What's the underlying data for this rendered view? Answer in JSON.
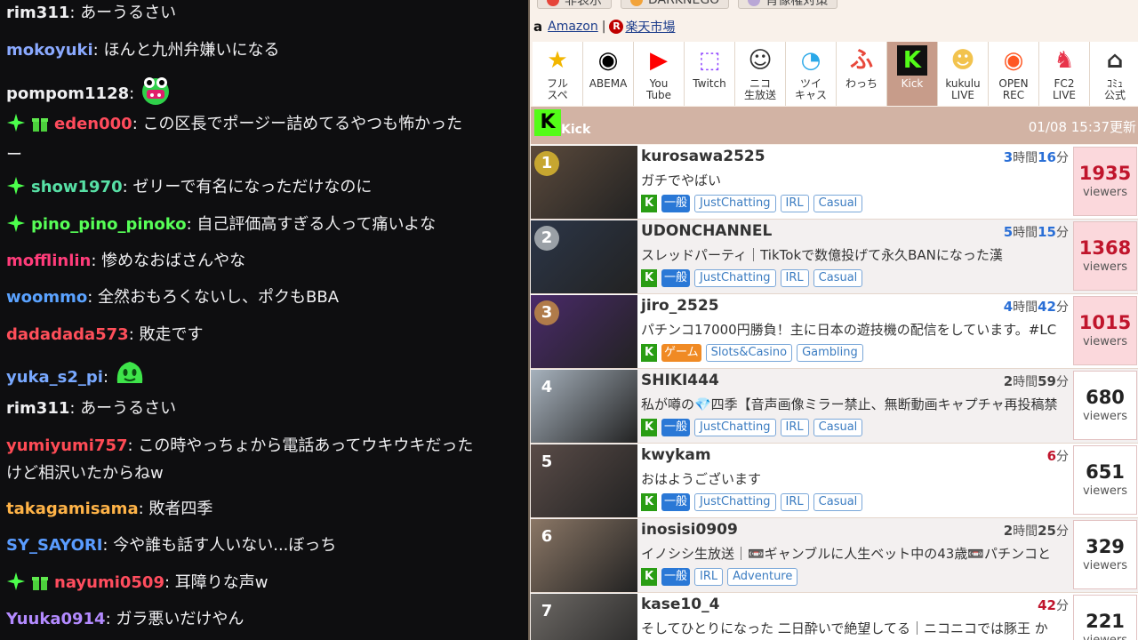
{
  "chat": {
    "messages": [
      {
        "user": "rim311",
        "color": "#efeff1",
        "text": "あーうるさい",
        "badges": []
      },
      {
        "user": "mokoyuki",
        "color": "#8aa9ff",
        "text": "ほんと九州弁嫌いになる",
        "badges": []
      },
      {
        "user": "pompom1128",
        "color": "#efeff1",
        "text": "",
        "badges": [],
        "emote": "frog-emote"
      },
      {
        "user": "eden000",
        "color": "#ff4b5c",
        "text": "この区長でポージー詰めてるやつも怖かった\nー",
        "badges": [
          "sparkle",
          "giftbox"
        ]
      },
      {
        "user": "show1970",
        "color": "#57e0a5",
        "text": "ゼリーで有名になっただけなのに",
        "badges": [
          "sparkle"
        ]
      },
      {
        "user": "pino_pino_pinoko",
        "color": "#57ff57",
        "text": "自己評価高すぎる人って痛いよな",
        "badges": [
          "sparkle"
        ]
      },
      {
        "user": "mofflinlin",
        "color": "#ff3c7a",
        "text": "惨めなおばさんやな",
        "badges": []
      },
      {
        "user": "woommo",
        "color": "#5aa2ff",
        "text": "全然おもろくないし、ポクもBBA",
        "badges": []
      },
      {
        "user": "dadadada573",
        "color": "#ff4f5a",
        "text": "敗走です",
        "badges": []
      },
      {
        "user": "yuka_s2_pi",
        "color": "#78a8ff",
        "text": "",
        "badges": [],
        "emote": "slime-emote"
      },
      {
        "user": "rim311",
        "color": "#efeff1",
        "text": "あーうるさい",
        "badges": []
      },
      {
        "user": "yumiyumi757",
        "color": "#ff4b55",
        "text": "この時やっちょから電話あってウキウキだった\nけど相沢いたからねw",
        "badges": []
      },
      {
        "user": "takagamisama",
        "color": "#ffb347",
        "text": "敗者四季",
        "badges": []
      },
      {
        "user": "SY_SAYORI",
        "color": "#5a9cff",
        "text": "今や誰も話す人いない...ぼっち",
        "badges": []
      },
      {
        "user": "nayumi0509",
        "color": "#ff4d5e",
        "text": "耳障りな声w",
        "badges": [
          "sparkle",
          "giftbox"
        ]
      },
      {
        "user": "Yuuka0914",
        "color": "#b38aff",
        "text": "ガラ悪いだけやん",
        "badges": []
      }
    ]
  },
  "toolbar": {
    "buttons": [
      {
        "label": "非表示",
        "icon": "hide-icon"
      },
      {
        "label": "DARKNEGO",
        "icon": "darknego-icon"
      },
      {
        "label": "肖像権対策",
        "icon": "portrait-icon"
      }
    ]
  },
  "links": {
    "amazon": "Amazon",
    "separator": "|",
    "rakuten": "楽天市場",
    "amazon_mark": "a",
    "rakuten_mark": "R"
  },
  "services": [
    {
      "label": "フル\nスペ",
      "icon": "star-icon",
      "glyph": "★",
      "color": "#f2b600"
    },
    {
      "label": "ABEMA",
      "icon": "abema-icon",
      "glyph": "◉",
      "color": "#000000"
    },
    {
      "label": "You\nTube",
      "icon": "youtube-icon",
      "glyph": "▶",
      "color": "#ff0000"
    },
    {
      "label": "Twitch",
      "icon": "twitch-icon",
      "glyph": "⬚",
      "color": "#9146ff"
    },
    {
      "label": "ニコ\n生放送",
      "icon": "niconico-icon",
      "glyph": "☺",
      "color": "#333333"
    },
    {
      "label": "ツイ\nキャス",
      "icon": "twitcasting-icon",
      "glyph": "◔",
      "color": "#2aa8e8"
    },
    {
      "label": "わっち",
      "icon": "wacchi-icon",
      "glyph": "ふ",
      "color": "#e8483b"
    },
    {
      "label": "Kick",
      "icon": "kick-icon",
      "glyph": "K",
      "color": "#53fc18",
      "active": true
    },
    {
      "label": "kukulu\nLIVE",
      "icon": "kukulu-icon",
      "glyph": "☻",
      "color": "#f2c34e"
    },
    {
      "label": "OPEN\nREC",
      "icon": "openrec-icon",
      "glyph": "◉",
      "color": "#ff5722"
    },
    {
      "label": "FC2\nLIVE",
      "icon": "fc2-icon",
      "glyph": "♞",
      "color": "#e8334a"
    },
    {
      "label": "ｺﾐｭ\n公式",
      "icon": "tv-icon",
      "glyph": "⌂",
      "color": "#333333"
    }
  ],
  "kick_header": {
    "logo": "K",
    "name": "Kick",
    "updated": "01/08 15:37更新"
  },
  "streams": [
    {
      "rank": "1",
      "rank_color": "#c6a630",
      "name": "kurosawa2525",
      "hours": "3",
      "mins": "16",
      "title": "ガチでやばい",
      "category": "一般",
      "category_color": "#2a78d6",
      "tags": [
        "JustChatting",
        "IRL",
        "Casual"
      ],
      "viewers": "1935",
      "hot": true,
      "thumb": "#5b4a3c"
    },
    {
      "rank": "2",
      "rank_color": "#9aa0a6",
      "name": "UDONCHANNEL",
      "hours": "5",
      "mins": "15",
      "title": "スレッドパーティ｜TikTokで数億投げて永久BANになった漢",
      "category": "一般",
      "category_color": "#2a78d6",
      "tags": [
        "JustChatting",
        "IRL",
        "Casual"
      ],
      "viewers": "1368",
      "hot": true,
      "thumb": "#2c3648"
    },
    {
      "rank": "3",
      "rank_color": "#b07b4a",
      "name": "jiro_2525",
      "hours": "4",
      "mins": "42",
      "title": "パチンコ17000円勝負！主に日本の遊技機の配信をしています。#LC",
      "category": "ゲーム",
      "category_color": "#f08a24",
      "tags": [
        "Slots&Casino",
        "Gambling"
      ],
      "viewers": "1015",
      "hot": true,
      "thumb": "#4a2a6a"
    },
    {
      "rank": "4",
      "rank_color": "transparent",
      "name": "SHIKI444",
      "hours": "2",
      "mins": "59",
      "title": "私が噂の💎四季【音声画像ミラー禁止、無断動画キャプチャ再投稿禁",
      "category": "一般",
      "category_color": "#2a78d6",
      "tags": [
        "JustChatting",
        "IRL",
        "Casual"
      ],
      "viewers": "680",
      "hot": false,
      "thumb": "#a7b2bd"
    },
    {
      "rank": "5",
      "rank_color": "transparent",
      "name": "kwykam",
      "hours": "",
      "mins": "6",
      "title": "おはようございます",
      "category": "一般",
      "category_color": "#2a78d6",
      "tags": [
        "JustChatting",
        "IRL",
        "Casual"
      ],
      "viewers": "651",
      "hot": false,
      "thumb": "#5a4c48"
    },
    {
      "rank": "6",
      "rank_color": "transparent",
      "name": "inosisi0909",
      "hours": "2",
      "mins": "25",
      "title": "イノシシ生放送｜📼ギャンブルに人生ベット中の43歳📼パチンコと",
      "category": "一般",
      "category_color": "#2a78d6",
      "tags": [
        "IRL",
        "Adventure"
      ],
      "viewers": "329",
      "hot": false,
      "thumb": "#8b7766"
    },
    {
      "rank": "7",
      "rank_color": "transparent",
      "name": "kase10_4",
      "hours": "",
      "mins": "42",
      "title": "そしてひとりになった 二日酔いで絶望してる｜ニコニコでは豚王 か",
      "category": "一般",
      "category_color": "#2a78d6",
      "tags": [],
      "viewers": "221",
      "hot": false,
      "thumb": "#6e6a66"
    }
  ],
  "labels": {
    "viewers": "viewers",
    "hour_unit": "時間",
    "min_unit": "分"
  }
}
